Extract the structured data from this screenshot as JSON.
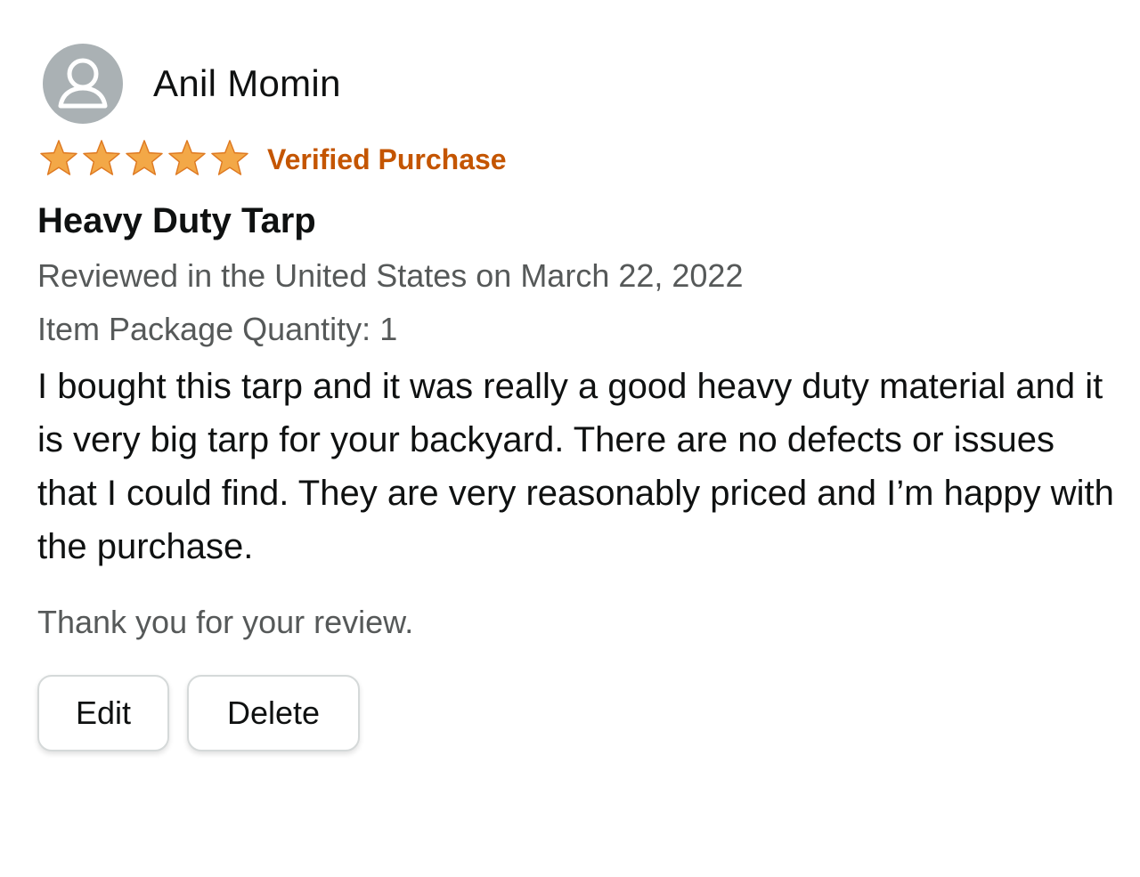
{
  "review": {
    "profile": {
      "avatar_icon": "user-silhouette-icon",
      "name": "Anil Momin"
    },
    "rating": {
      "stars": 5,
      "max_stars": 5,
      "star_color": "#f3a847",
      "verified_label": "Verified Purchase",
      "verified_color": "#c45500"
    },
    "title": "Heavy Duty Tarp",
    "reviewed_line": "Reviewed in the United States on March 22, 2022",
    "quantity_line": "Item Package Quantity: 1",
    "body": "I bought this tarp and it was really a good heavy duty material and it is very big tarp for your backyard. There are no defects or issues that I could find. They are very reasonably priced and I’m happy with the purchase.",
    "thanks": "Thank you for your review.",
    "actions": {
      "edit_label": "Edit",
      "delete_label": "Delete"
    }
  }
}
